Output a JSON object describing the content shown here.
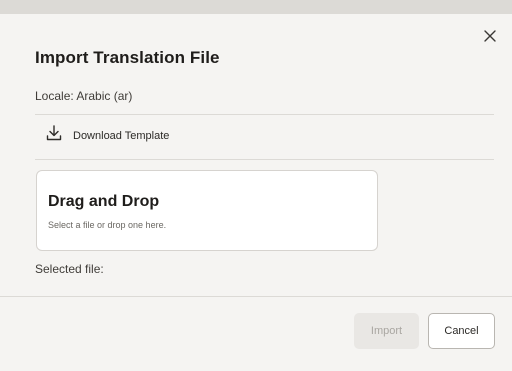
{
  "dialog": {
    "title": "Import Translation File",
    "locale_text": "Locale: Arabic (ar)",
    "close_icon": "close-icon"
  },
  "download": {
    "icon": "download-icon",
    "label": "Download Template"
  },
  "dropzone": {
    "title": "Drag and Drop",
    "subtitle": "Select a file or drop one here."
  },
  "selected_file": {
    "label": "Selected file:"
  },
  "footer": {
    "import_label": "Import",
    "cancel_label": "Cancel",
    "import_disabled": true
  }
}
